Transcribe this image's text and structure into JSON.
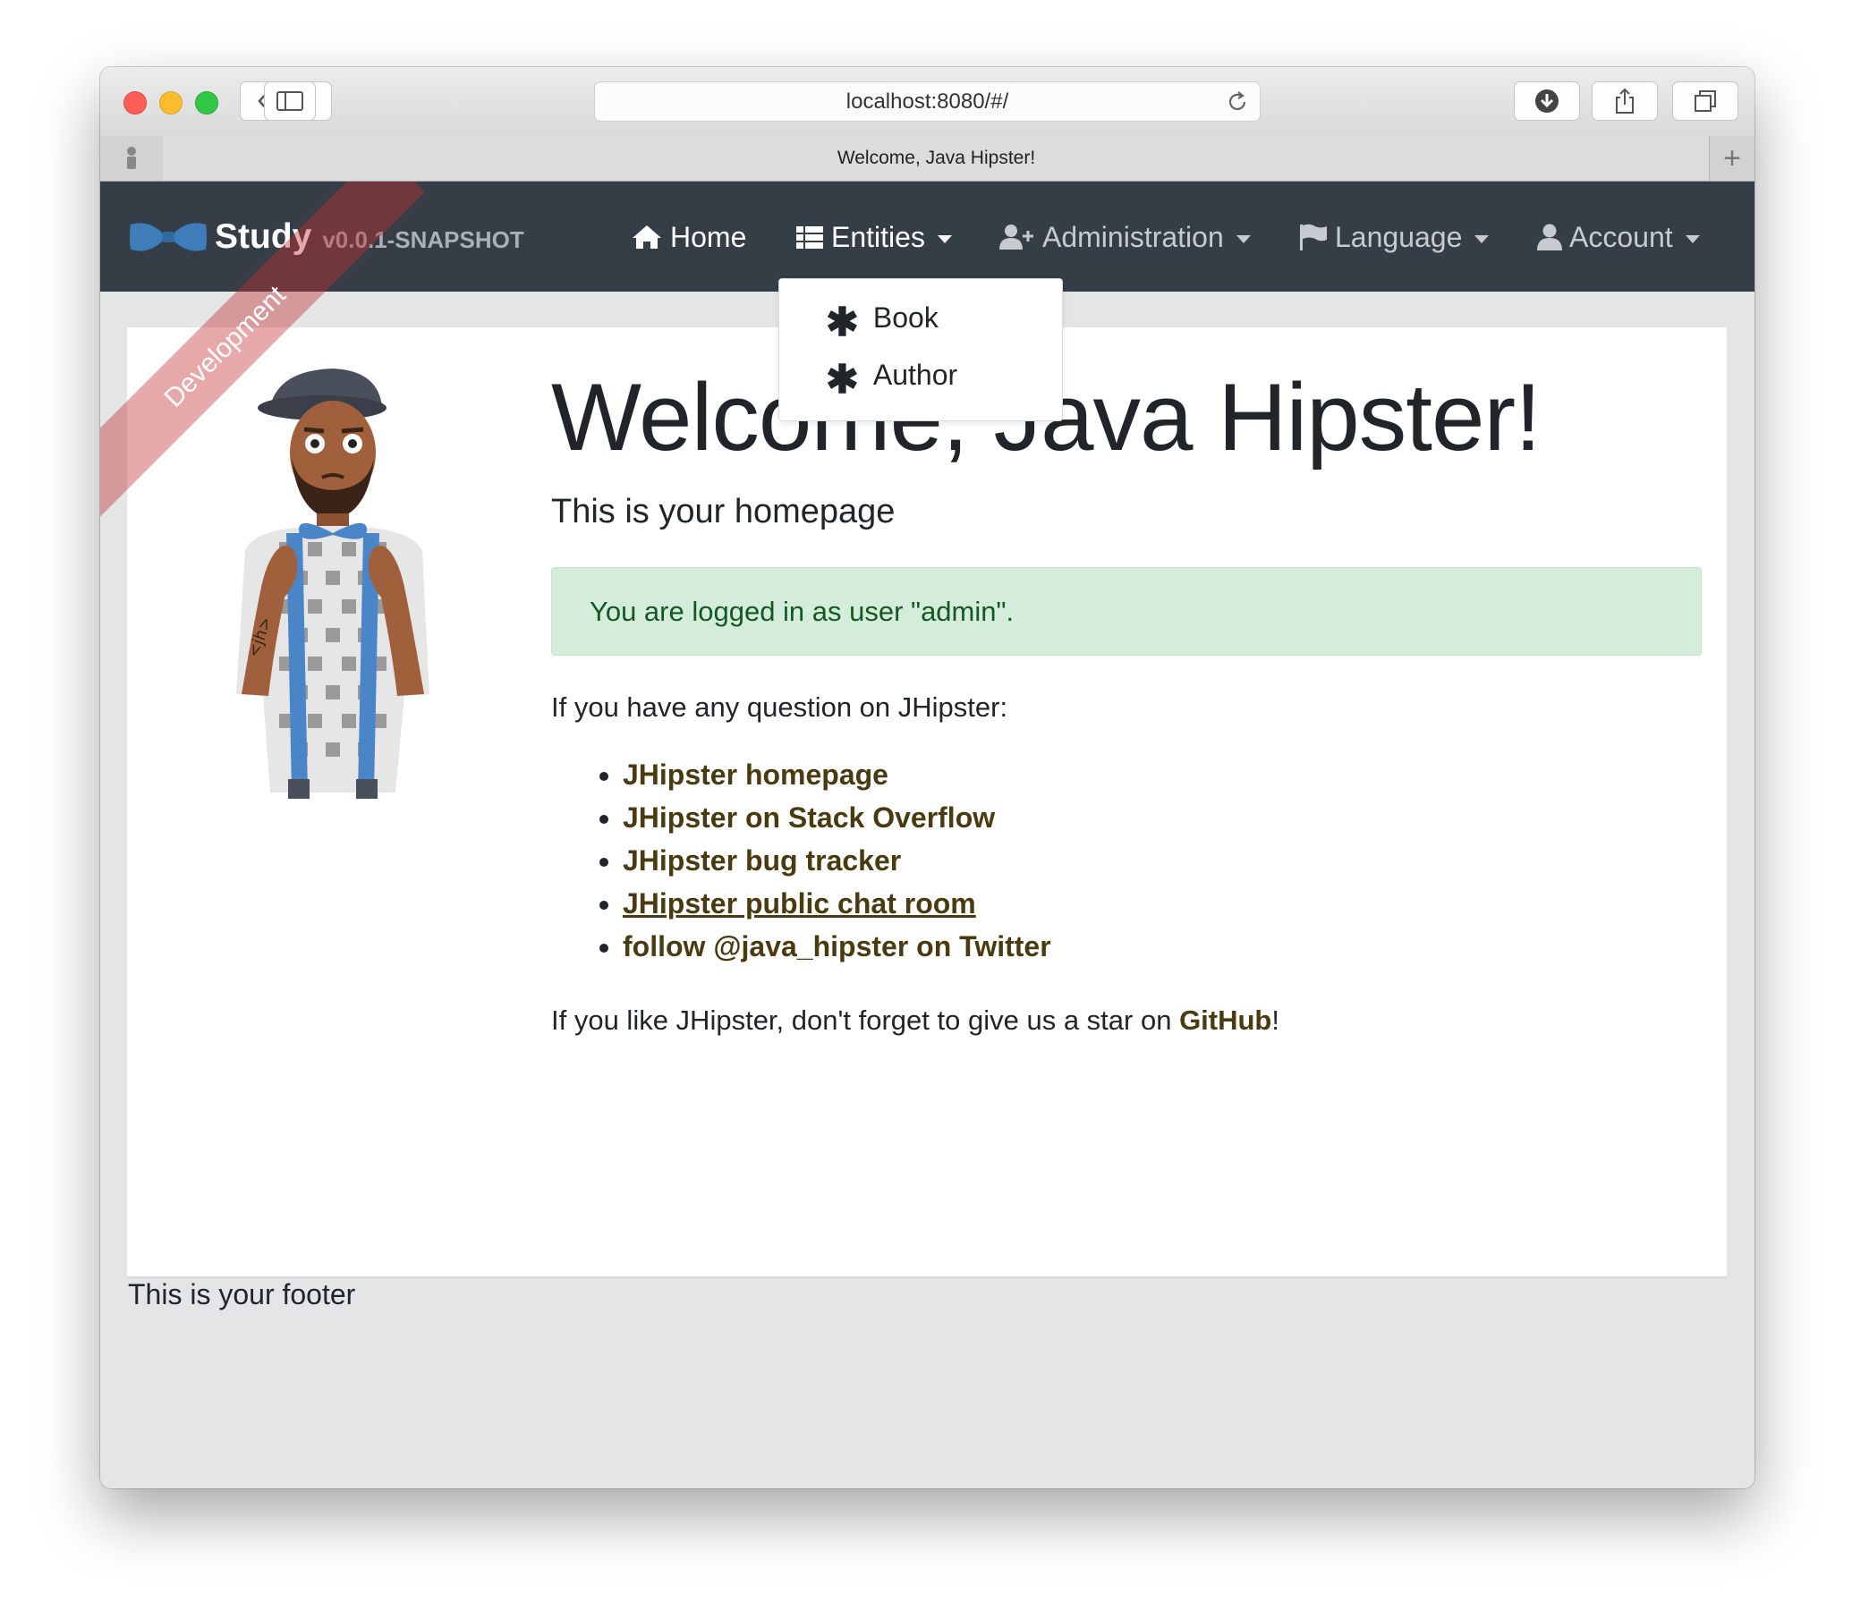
{
  "browser": {
    "url": "localhost:8080/#/",
    "tab_title": "Welcome, Java Hipster!"
  },
  "navbar": {
    "brand_title": "Study",
    "brand_version": "v0.0.1-SNAPSHOT",
    "ribbon": "Development",
    "items": [
      {
        "label": "Home",
        "icon": "home-icon"
      },
      {
        "label": "Entities",
        "icon": "list-icon"
      },
      {
        "label": "Administration",
        "icon": "user-plus-icon"
      },
      {
        "label": "Language",
        "icon": "flag-icon"
      },
      {
        "label": "Account",
        "icon": "user-icon"
      }
    ]
  },
  "entities_menu": {
    "items": [
      {
        "label": "Book",
        "icon": "asterisk-icon"
      },
      {
        "label": "Author",
        "icon": "asterisk-icon"
      }
    ]
  },
  "main": {
    "title": "Welcome, Java Hipster!",
    "subtitle": "This is your homepage",
    "alert": "You are logged in as user \"admin\".",
    "question": "If you have any question on JHipster:",
    "links": [
      "JHipster homepage",
      "JHipster on Stack Overflow",
      "JHipster bug tracker",
      "JHipster public chat room",
      "follow @java_hipster on Twitter"
    ],
    "like_prefix": "If you like JHipster, don't forget to give us a star on ",
    "like_link": "GitHub",
    "like_suffix": "!"
  },
  "footer": {
    "text": "This is your footer"
  },
  "colors": {
    "navbar_bg": "#353d47",
    "alert_bg": "#d4edda",
    "alert_text": "#155724",
    "link": "#4a3a10",
    "ribbon": "#c42f2f"
  }
}
